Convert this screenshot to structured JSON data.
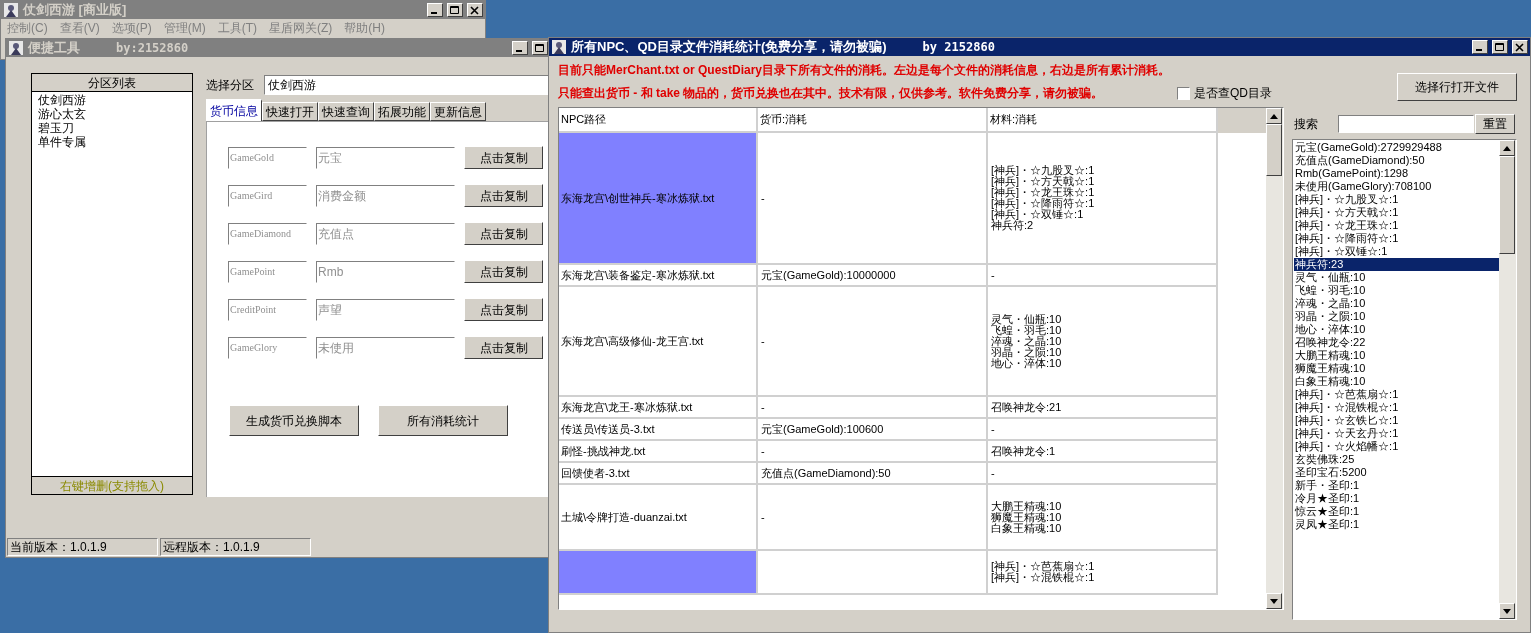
{
  "main_window": {
    "title": "仗剑西游 [商业版]",
    "active": false,
    "menu": [
      "控制(C)",
      "查看(V)",
      "选项(P)",
      "管理(M)",
      "工具(T)",
      "星盾网关(Z)",
      "帮助(H)"
    ]
  },
  "tool_window": {
    "title": "便捷工具",
    "author": "by:2152860",
    "active": false,
    "partition_list": {
      "header": "分区列表",
      "items": [
        "仗剑西游",
        "游心太玄",
        "碧玉刀",
        "单件专属"
      ],
      "footer": "右键增删(支持拖入)"
    },
    "select_label": "选择分区",
    "select_value": "仗剑西游",
    "tabs": [
      {
        "label": "货币信息",
        "selected": true
      },
      {
        "label": "快速打开",
        "selected": false
      },
      {
        "label": "快速查询",
        "selected": false
      },
      {
        "label": "拓展功能",
        "selected": false
      },
      {
        "label": "更新信息",
        "selected": false
      }
    ],
    "currency_rows": [
      {
        "key_field": {
          "placeholder": "GameGold"
        },
        "name_field": {
          "placeholder": "元宝"
        },
        "button": "点击复制"
      },
      {
        "key_field": {
          "placeholder": "GameGird"
        },
        "name_field": {
          "placeholder": "消费金额"
        },
        "button": "点击复制"
      },
      {
        "key_field": {
          "placeholder": "GameDiamond"
        },
        "name_field": {
          "placeholder": "充值点"
        },
        "button": "点击复制"
      },
      {
        "key_field": {
          "placeholder": "GamePoint"
        },
        "name_field": {
          "placeholder": "Rmb"
        },
        "button": "点击复制"
      },
      {
        "key_field": {
          "placeholder": "CreditPoint"
        },
        "name_field": {
          "placeholder": "声望"
        },
        "button": "点击复制"
      },
      {
        "key_field": {
          "placeholder": "GameGlory"
        },
        "name_field": {
          "placeholder": "未使用"
        },
        "button": "点击复制"
      }
    ],
    "actions": [
      "生成货币兑换脚本",
      "所有消耗统计"
    ],
    "status_bar": [
      "当前版本：1.0.1.9",
      "远程版本：1.0.1.9"
    ]
  },
  "stats_window": {
    "title": "所有NPC、QD目录文件消耗统计(免费分享，请勿被骗)",
    "author": "by 2152860",
    "active": true,
    "notices": [
      "目前只能MerChant.txt or QuestDiary目录下所有文件的消耗。左边是每个文件的消耗信息，右边是所有累计消耗。",
      "只能查出货币 - 和 take 物品的，货币兑换也在其中。技术有限，仅供参考。软件免费分享，请勿被骗。"
    ],
    "qd_checkbox": {
      "label": "是否查QD目录",
      "checked": false
    },
    "table": {
      "columns": [
        "NPC路径",
        "货币:消耗",
        "材料:消耗"
      ],
      "rows": [
        {
          "path": "东海龙宫\\创世神兵-寒冰炼狱.txt",
          "currency": "-",
          "materials": [
            "[神兵]・☆九股叉☆:1",
            "[神兵]・☆方天戟☆:1",
            "[神兵]・☆龙王珠☆:1",
            "[神兵]・☆降雨符☆:1",
            "[神兵]・☆双锤☆:1",
            "神兵符:2"
          ],
          "selected": true
        },
        {
          "path": "东海龙宫\\装备鉴定-寒冰炼狱.txt",
          "currency": "元宝(GameGold):10000000",
          "materials": [
            "-"
          ],
          "selected": false
        },
        {
          "path": "东海龙宫\\高级修仙-龙王宫.txt",
          "currency": "-",
          "materials": [
            "灵气・仙瓶:10",
            "飞蝗・羽毛:10",
            "淬魂・之晶:10",
            "羽晶・之陨:10",
            "地心・淬体:10"
          ],
          "selected": false
        },
        {
          "path": "东海龙宫\\龙王-寒冰炼狱.txt",
          "currency": "-",
          "materials": [
            "召唤神龙令:21"
          ],
          "selected": false
        },
        {
          "path": "传送员\\传送员-3.txt",
          "currency": "元宝(GameGold):100600",
          "materials": [
            "-"
          ],
          "selected": false
        },
        {
          "path": "刷怪-挑战神龙.txt",
          "currency": "-",
          "materials": [
            "召唤神龙令:1"
          ],
          "selected": false
        },
        {
          "path": "回馈使者-3.txt",
          "currency": "充值点(GameDiamond):50",
          "materials": [
            "-"
          ],
          "selected": false
        },
        {
          "path": "土城\\令牌打造-duanzai.txt",
          "currency": "-",
          "materials": [
            "大鹏王精魂:10",
            "狮魔王精魂:10",
            "白象王精魂:10"
          ],
          "selected": false
        },
        {
          "materials": [
            "[神兵]・☆芭蕉扇☆:1",
            "[神兵]・☆混铁棍☆:1"
          ],
          "selected": true
        }
      ]
    },
    "open_button": "选择行打开文件",
    "search": {
      "label": "搜索",
      "button": "重置"
    },
    "totals": [
      {
        "label": "元宝(GameGold):2729929488",
        "selected": false
      },
      {
        "label": "充值点(GameDiamond):50",
        "selected": false
      },
      {
        "label": "Rmb(GamePoint):1298",
        "selected": false
      },
      {
        "label": "未使用(GameGlory):708100",
        "selected": false
      },
      {
        "label": "[神兵]・☆九股叉☆:1",
        "selected": false
      },
      {
        "label": "[神兵]・☆方天戟☆:1",
        "selected": false
      },
      {
        "label": "[神兵]・☆龙王珠☆:1",
        "selected": false
      },
      {
        "label": "[神兵]・☆降雨符☆:1",
        "selected": false
      },
      {
        "label": "[神兵]・☆双锤☆:1",
        "selected": false
      },
      {
        "label": "神兵符:23",
        "selected": true
      },
      {
        "label": "灵气・仙瓶:10",
        "selected": false
      },
      {
        "label": "飞蝗・羽毛:10",
        "selected": false
      },
      {
        "label": "淬魂・之晶:10",
        "selected": false
      },
      {
        "label": "羽晶・之陨:10",
        "selected": false
      },
      {
        "label": "地心・淬体:10",
        "selected": false
      },
      {
        "label": "召唤神龙令:22",
        "selected": false
      },
      {
        "label": "大鹏王精魂:10",
        "selected": false
      },
      {
        "label": "狮魔王精魂:10",
        "selected": false
      },
      {
        "label": "白象王精魂:10",
        "selected": false
      },
      {
        "label": "[神兵]・☆芭蕉扇☆:1",
        "selected": false
      },
      {
        "label": "[神兵]・☆混铁棍☆:1",
        "selected": false
      },
      {
        "label": "[神兵]・☆玄铁匕☆:1",
        "selected": false
      },
      {
        "label": "[神兵]・☆天玄丹☆:1",
        "selected": false
      },
      {
        "label": "[神兵]・☆火焰幡☆:1",
        "selected": false
      },
      {
        "label": "玄奘佛珠:25",
        "selected": false
      },
      {
        "label": "圣印宝石:5200",
        "selected": false
      },
      {
        "label": "新手・圣印:1",
        "selected": false
      },
      {
        "label": "冷月★圣印:1",
        "selected": false
      },
      {
        "label": "惊云★圣印:1",
        "selected": false
      },
      {
        "label": "灵凤★圣印:1",
        "selected": false
      }
    ]
  }
}
